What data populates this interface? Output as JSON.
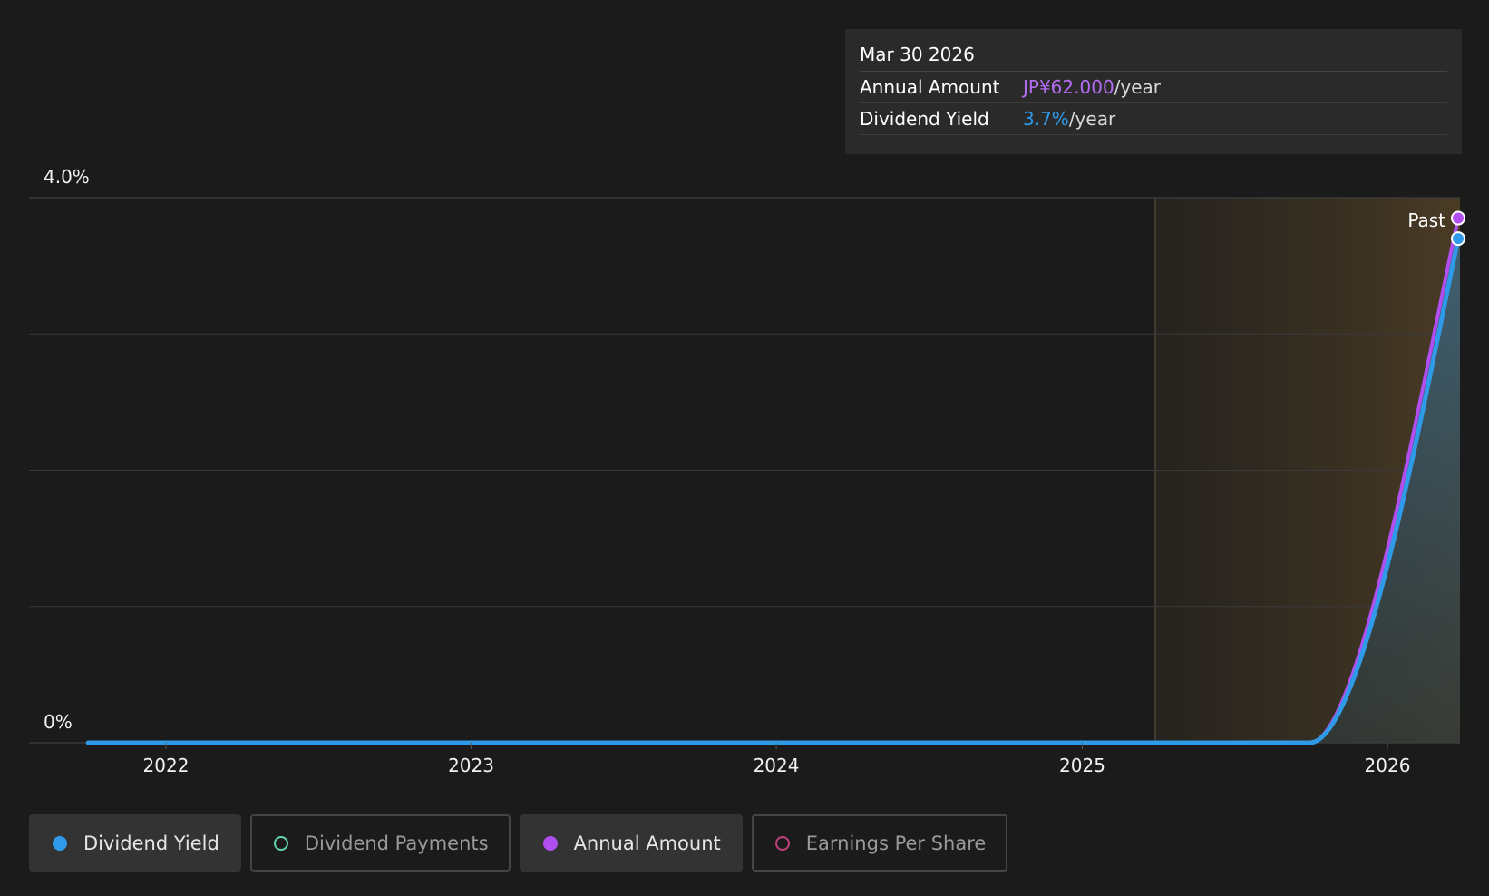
{
  "tooltip": {
    "date": "Mar 30 2026",
    "annual_amount_label": "Annual Amount",
    "annual_amount_value": "JP¥62.000",
    "annual_amount_unit": "/year",
    "dividend_yield_label": "Dividend Yield",
    "dividend_yield_value": "3.7%",
    "dividend_yield_unit": "/year"
  },
  "legend": {
    "items": [
      {
        "label": "Dividend Yield",
        "color": "#2f9ae8",
        "active": true,
        "marker": "filled"
      },
      {
        "label": "Dividend Payments",
        "color": "#5fd4b4",
        "active": false,
        "marker": "ring"
      },
      {
        "label": "Annual Amount",
        "color": "#b04ef0",
        "active": true,
        "marker": "filled"
      },
      {
        "label": "Earnings Per Share",
        "color": "#c2407a",
        "active": false,
        "marker": "ring"
      }
    ]
  },
  "chart_data": {
    "type": "area",
    "ylim": [
      0,
      4.0
    ],
    "y_tick_labels": [
      "4.0%",
      "0%"
    ],
    "x_tick_labels": [
      "2022",
      "2023",
      "2024",
      "2025",
      "2026"
    ],
    "gridlines": true,
    "past_region_label": "Past",
    "series": [
      {
        "name": "Dividend Yield",
        "color": "#2f9ae8",
        "unit": "%",
        "points": [
          {
            "x": "2021-09-30",
            "y": 0
          },
          {
            "x": "2022-03-31",
            "y": 0
          },
          {
            "x": "2023-03-31",
            "y": 0
          },
          {
            "x": "2024-03-31",
            "y": 0
          },
          {
            "x": "2025-03-31",
            "y": 0
          },
          {
            "x": "2025-09-30",
            "y": 0
          },
          {
            "x": "2025-11-30",
            "y": 0.8
          },
          {
            "x": "2026-01-31",
            "y": 2.3
          },
          {
            "x": "2026-03-30",
            "y": 3.7
          }
        ]
      },
      {
        "name": "Annual Amount",
        "color": "#b04ef0",
        "unit": "JP¥",
        "points": [
          {
            "x": "2021-09-30",
            "y": 0
          },
          {
            "x": "2025-09-30",
            "y": 0
          },
          {
            "x": "2026-03-30",
            "y": 62.0
          }
        ]
      }
    ],
    "legend_placement": "bottom-left"
  }
}
